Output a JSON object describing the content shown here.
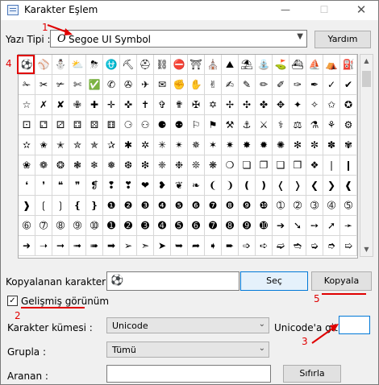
{
  "window": {
    "title": "Karakter Eşlem",
    "min_icon": "—",
    "max_icon": "☐",
    "close_icon": "✕"
  },
  "font_row": {
    "label": "Yazı Tipi :",
    "selected_font": "Segoe UI Symbol",
    "font_icon": "O",
    "help_button": "Yardım"
  },
  "character_grid": [
    [
      "⚽",
      "⚾",
      "⛄",
      "⛅",
      "⛈",
      "⛎",
      "⛏",
      "⛑",
      "⛓",
      "⛔",
      "⛩",
      "⛪",
      "⛰",
      "⛱",
      "⛲",
      "⛳",
      "⛴",
      "⛵",
      "⛺",
      "⛽"
    ],
    [
      "✁",
      "✂",
      "✃",
      "✄",
      "✅",
      "✆",
      "✇",
      "✈",
      "✉",
      "✊",
      "✋",
      "✌",
      "✍",
      "✎",
      "✏",
      "✐",
      "✑",
      "✒",
      "✓",
      "✔"
    ],
    [
      "☆",
      "✗",
      "✘",
      "✙",
      "✚",
      "✛",
      "✜",
      "✝",
      "✞",
      "✟",
      "✠",
      "✡",
      "✢",
      "✣",
      "✤",
      "✥",
      "✦",
      "✧",
      "✩",
      "✪"
    ],
    [
      "⚀",
      "⚁",
      "⚂",
      "⚃",
      "⚄",
      "⚅",
      "⚆",
      "⚇",
      "⚈",
      "⚉",
      "⚐",
      "⚑",
      "⚒",
      "⚓",
      "⚔",
      "⚕",
      "⚖",
      "⚗",
      "⚘",
      "⚙"
    ],
    [
      "✫",
      "✬",
      "✭",
      "✮",
      "✯",
      "✰",
      "✱",
      "✲",
      "✳",
      "✴",
      "✵",
      "✶",
      "✷",
      "✸",
      "✹",
      "✺",
      "✻",
      "✼",
      "✽",
      "✾"
    ],
    [
      "❀",
      "❁",
      "❂",
      "❃",
      "❄",
      "❅",
      "❆",
      "❇",
      "❈",
      "❉",
      "❊",
      "❋",
      "❍",
      "❏",
      "❐",
      "❑",
      "❒",
      "❖",
      "❘",
      "❙"
    ],
    [
      "❛",
      "❜",
      "❝",
      "❞",
      "❡",
      "❢",
      "❣",
      "❤",
      "❥",
      "❦",
      "❧",
      "❨",
      "❩",
      "❪",
      "❫",
      "❬",
      "❭",
      "❮",
      "❯",
      "❰"
    ],
    [
      "❱",
      "❲",
      "❳",
      "❴",
      "❵",
      "❶",
      "❷",
      "❸",
      "❹",
      "❺",
      "❻",
      "❼",
      "❽",
      "❾",
      "❿",
      "➀",
      "➁",
      "➂",
      "➃",
      "➄"
    ],
    [
      "➅",
      "➆",
      "➇",
      "➈",
      "➉",
      "➊",
      "➋",
      "➌",
      "➍",
      "➎",
      "➏",
      "➐",
      "➑",
      "➒",
      "➓",
      "➔",
      "➘",
      "➙",
      "➚",
      "➛"
    ],
    [
      "➜",
      "➝",
      "➞",
      "➟",
      "➠",
      "➡",
      "➢",
      "➣",
      "➤",
      "➥",
      "➦",
      "➧",
      "➨",
      "➩",
      "➪",
      "➫",
      "➬",
      "➭",
      "➮",
      "➯"
    ]
  ],
  "copy_row": {
    "label": "Kopyalanan karakterler :",
    "value": "⚽",
    "select_button": "Seç",
    "copy_button": "Kopyala"
  },
  "advanced": {
    "checkbox_label": "Gelişmiş görünüm",
    "checked": true,
    "check_glyph": "✓"
  },
  "charset_row": {
    "label": "Karakter kümesi :",
    "value": "Unicode",
    "goto_label": "Unicode'a git :",
    "goto_value": ""
  },
  "group_row": {
    "label": "Grupla :",
    "value": "Tümü"
  },
  "search_row": {
    "label": "Aranan :",
    "value": "",
    "clear_button": "Sıfırla"
  },
  "annotations": {
    "n1": "1",
    "n2": "2",
    "n3": "3",
    "n4": "4",
    "n5": "5"
  },
  "colors": {
    "annotation": "#e00000",
    "select_border": "#0078d7"
  }
}
